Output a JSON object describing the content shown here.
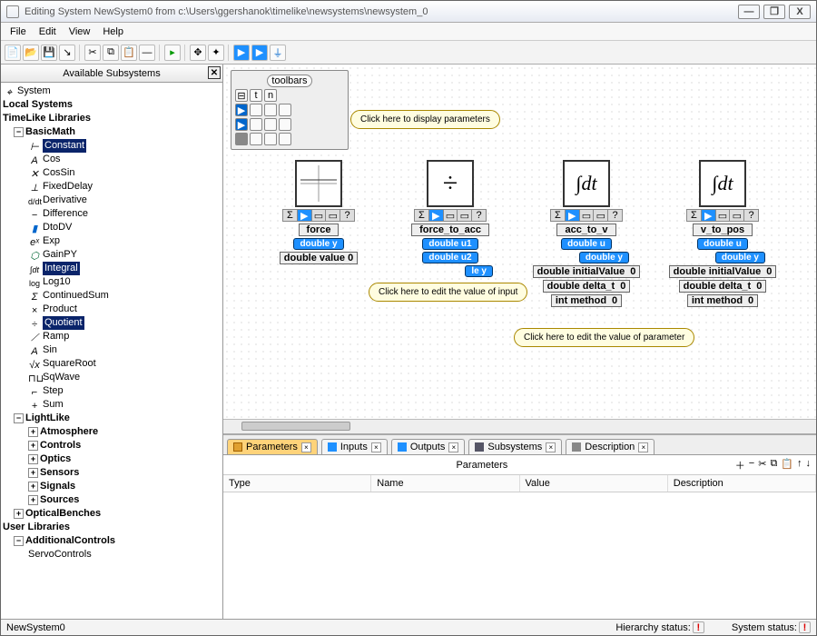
{
  "window": {
    "title": "Editing System NewSystem0 from c:\\Users\\ggershanok\\timelike\\newsystems\\newsystem_0",
    "btn_min": "—",
    "btn_max": "❐",
    "btn_close": "X"
  },
  "menu": {
    "file": "File",
    "edit": "Edit",
    "view": "View",
    "help": "Help"
  },
  "sidebar": {
    "title": "Available Subsystems",
    "groups": {
      "system": "System",
      "local": "Local Systems",
      "tl": "TimeLike Libraries",
      "basicmath": "BasicMath",
      "lightlike": "LightLike",
      "optbench": "OpticalBenches",
      "userlib": "User Libraries",
      "addctl": "AdditionalControls"
    },
    "bm": {
      "constant": "Constant",
      "cos": "Cos",
      "cossin": "CosSin",
      "fixed": "FixedDelay",
      "deriv": "Derivative",
      "diff": "Difference",
      "dtodv": "DtoDV",
      "exp": "Exp",
      "gain": "GainPY",
      "integral": "Integral",
      "log10": "Log10",
      "csum": "ContinuedSum",
      "prod": "Product",
      "quot": "Quotient",
      "ramp": "Ramp",
      "sin": "Sin",
      "sqrt": "SquareRoot",
      "sqw": "SqWave",
      "step": "Step",
      "sum": "Sum"
    },
    "ll": {
      "atm": "Atmosphere",
      "ctrl": "Controls",
      "opt": "Optics",
      "sen": "Sensors",
      "sig": "Signals",
      "src": "Sources"
    },
    "ac": {
      "servo": "ServoControls"
    }
  },
  "toolbox": {
    "title": "toolbars",
    "tip_params": "Click here to display\nparameters"
  },
  "nodes": {
    "force": {
      "name": "force",
      "p1": "double y",
      "p2": "double value 0"
    },
    "f2a": {
      "name": "force_to_acc",
      "p1": "double u1",
      "p2": "double u2",
      "p3": "le y"
    },
    "a2v": {
      "name": "acc_to_v",
      "p1": "double u",
      "p2": "double y",
      "p3": "double initialValue",
      "p3v": "0",
      "p4": "double delta_t",
      "p4v": "0",
      "p5": "int      method",
      "p5v": "0"
    },
    "v2p": {
      "name": "v_to_pos",
      "p1": "double u",
      "p2": "double y",
      "p3": "double initialValue",
      "p3v": "0",
      "p4": "double delta_t",
      "p4v": "0",
      "p5": "int      method",
      "p5v": "0"
    }
  },
  "tips": {
    "edit_input": "Click here to edit the\nvalue of input",
    "edit_param": "Click here to edit the\nvalue of parameter"
  },
  "tabs": {
    "params": "Parameters",
    "inputs": "Inputs",
    "outputs": "Outputs",
    "subs": "Subsystems",
    "desc": "Description",
    "heading": "Parameters",
    "cols": {
      "type": "Type",
      "name": "Name",
      "value": "Value",
      "desc": "Description"
    }
  },
  "status": {
    "left": "NewSystem0",
    "hier": "Hierarchy status:",
    "sys": "System status:"
  }
}
